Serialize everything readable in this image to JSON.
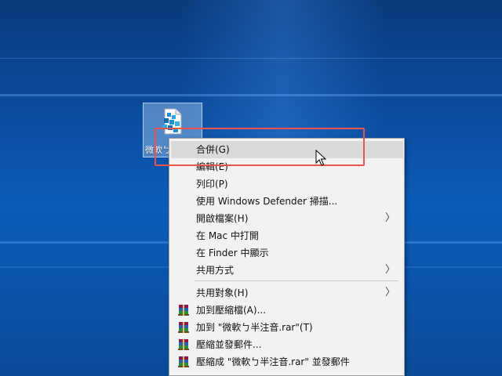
{
  "desktop": {
    "file_label": "微軟ㄅ半注音.rar"
  },
  "menu": {
    "items": [
      {
        "label": "合併(G)",
        "submenu": false,
        "icon": null
      },
      {
        "label": "編輯(E)",
        "submenu": false,
        "icon": null
      },
      {
        "label": "列印(P)",
        "submenu": false,
        "icon": null
      },
      {
        "label": "使用 Windows Defender 掃描...",
        "submenu": false,
        "icon": null
      },
      {
        "label": "開啟檔案(H)",
        "submenu": true,
        "icon": null
      },
      {
        "label": "在 Mac 中打開",
        "submenu": false,
        "icon": null
      },
      {
        "label": "在 Finder 中顯示",
        "submenu": false,
        "icon": null
      },
      {
        "label": "共用方式",
        "submenu": true,
        "icon": null
      },
      {
        "label": "共用對象(H)",
        "submenu": true,
        "icon": null
      },
      {
        "label": "加到壓縮檔(A)...",
        "submenu": false,
        "icon": "winrar-icon"
      },
      {
        "label": "加到 \"微軟ㄅ半注音.rar\"(T)",
        "submenu": false,
        "icon": "winrar-icon"
      },
      {
        "label": "壓縮並發郵件...",
        "submenu": false,
        "icon": "winrar-icon"
      },
      {
        "label": "壓縮成 \"微軟ㄅ半注音.rar\" 並發郵件",
        "submenu": false,
        "icon": "winrar-icon"
      }
    ],
    "arrow_glyph": "〉"
  },
  "colors": {
    "highlight_box": "#e8544a",
    "menu_bg": "#f2f2f2",
    "hover_bg": "#dadada"
  }
}
